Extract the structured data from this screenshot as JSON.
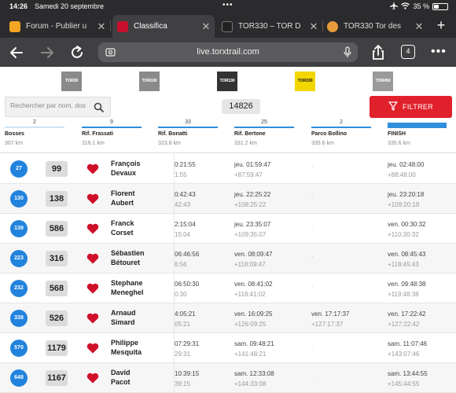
{
  "status_bar": {
    "time": "14:26",
    "date": "Samedi 20 septembre",
    "battery": "35 %",
    "battery_level": 0.35
  },
  "tabs": [
    {
      "title": "Forum - Publier u",
      "favicon_color": "#f4a523",
      "favicon_text": "K",
      "active": false
    },
    {
      "title": "Classifica",
      "favicon_color": "#c8102e",
      "favicon_text": "TOR",
      "active": true
    },
    {
      "title": "TOR330 – TOR D",
      "favicon_color": "#222222",
      "favicon_text": "TOR",
      "active": false
    },
    {
      "title": "TOR330 Tor des",
      "favicon_color": "#e89b3a",
      "favicon_text": "",
      "active": false
    }
  ],
  "toolbar": {
    "url": "live.torxtrail.com",
    "tab_count": "4"
  },
  "race_logos": [
    {
      "label": "TOR30",
      "color": "#8a8a8a",
      "text_color": "#ffffff"
    },
    {
      "label": "TOR100",
      "color": "#8a8a8a",
      "text_color": "#ffffff"
    },
    {
      "label": "TOR130",
      "color": "#333333",
      "text_color": "#ffffff"
    },
    {
      "label": "TOR330",
      "color": "#f3d600",
      "text_color": "#222222"
    },
    {
      "label": "TOR450",
      "color": "#9a9a9a",
      "text_color": "#ffffff"
    }
  ],
  "filters": {
    "search_placeholder": "Rechercher par nom, dos",
    "bib_value": "14826",
    "filter_label": "FILTRER"
  },
  "checkpoints": [
    {
      "name": "Bosses",
      "km": "307 km",
      "count": "2",
      "bar_fraction": 0.12
    },
    {
      "name": "Rif. Frassati",
      "km": "316.1 km",
      "count": "9",
      "bar_fraction": 0.45
    },
    {
      "name": "Rif. Bonatti",
      "km": "323.8 km",
      "count": "33",
      "bar_fraction": 1.0
    },
    {
      "name": "Rif. Bertone",
      "km": "331.2 km",
      "count": "25",
      "bar_fraction": 1.0
    },
    {
      "name": "Parco Bollino",
      "km": "335.6 km",
      "count": "2",
      "bar_fraction": 0.1
    },
    {
      "name": "FINISH",
      "km": "335.6 km",
      "count": "",
      "bar_fraction": 1.0
    }
  ],
  "rows": [
    {
      "rank": "27",
      "bib": "99",
      "first": "François",
      "last": "Devaux",
      "bonatti": [
        "0:21:55",
        "1:55"
      ],
      "bertone": [
        "jeu. 01:59:47",
        "+87:59:47"
      ],
      "bollino": null,
      "finish": [
        "jeu. 02:48:00",
        "+88:48:00"
      ]
    },
    {
      "rank": "130",
      "bib": "138",
      "first": "Florent",
      "last": "Aubert",
      "bonatti": [
        "0:42:43",
        "42:43"
      ],
      "bertone": [
        "jeu. 22:25:22",
        "+108:25:22"
      ],
      "bollino": null,
      "finish": [
        "jeu. 23:20:18",
        "+109:20:18"
      ]
    },
    {
      "rank": "139",
      "bib": "586",
      "first": "Franck",
      "last": "Corset",
      "bonatti": [
        "2:15:04",
        "15:04"
      ],
      "bertone": [
        "jeu. 23:35:07",
        "+109:35:07"
      ],
      "bollino": null,
      "finish": [
        "ven. 00:30:32",
        "+110:30:32"
      ]
    },
    {
      "rank": "223",
      "bib": "316",
      "first": "Sébastien",
      "last": "Bétouret",
      "bonatti": [
        "06:46:56",
        "6:56"
      ],
      "bertone": [
        "ven. 08:09:47",
        "+118:09:47"
      ],
      "bollino": null,
      "finish": [
        "ven. 08:45:43",
        "+118:45:43"
      ]
    },
    {
      "rank": "232",
      "bib": "568",
      "first": "Stephane",
      "last": "Meneghel",
      "bonatti": [
        "06:50:30",
        "0:30"
      ],
      "bertone": [
        "ven. 08:41:02",
        "+118:41:02"
      ],
      "bollino": null,
      "finish": [
        "ven. 09:48:38",
        "+119:48:38"
      ]
    },
    {
      "rank": "338",
      "bib": "526",
      "first": "Arnaud",
      "last": "Simard",
      "bonatti": [
        "4:05:21",
        "05:21"
      ],
      "bertone": [
        "ven. 16:09:25",
        "+126:09:25"
      ],
      "bollino": [
        "ven. 17:17:37",
        "+127:17:37"
      ],
      "finish": [
        "ven. 17:22:42",
        "+127:22:42"
      ]
    },
    {
      "rank": "570",
      "bib": "1179",
      "first": "Philippe",
      "last": "Mesquita",
      "bonatti": [
        "07:29:31",
        "29:31"
      ],
      "bertone": [
        "sam. 09:48:21",
        "+141:48:21"
      ],
      "bollino": null,
      "finish": [
        "sam. 11:07:46",
        "+143:07:46"
      ]
    },
    {
      "rank": "648",
      "bib": "1167",
      "first": "David",
      "last": "Pacot",
      "bonatti": [
        "10:39:15",
        "39:15"
      ],
      "bertone": [
        "sam. 12:33:08",
        "+144:33:08"
      ],
      "bollino": null,
      "finish": [
        "sam. 13:44:55",
        "+145:44:55"
      ]
    }
  ],
  "empty_cell": "-",
  "icons": [
    "back-arrow-icon",
    "forward-arrow-icon",
    "reload-icon",
    "site-settings-icon",
    "microphone-icon",
    "share-icon",
    "tabs-icon",
    "more-icon",
    "search-icon",
    "filter-funnel-icon",
    "favorite-heart-icon",
    "wifi-icon",
    "airplane-icon",
    "battery-icon"
  ]
}
